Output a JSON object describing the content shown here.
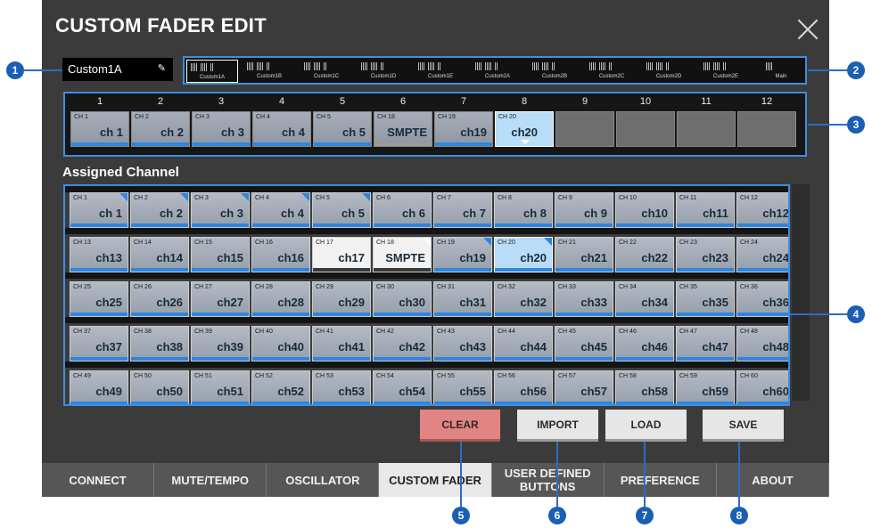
{
  "title": "CUSTOM FADER EDIT",
  "name_field": {
    "value": "Custom1A"
  },
  "banks": [
    {
      "label": "Custom1A",
      "selected": true
    },
    {
      "label": "Custom1B"
    },
    {
      "label": "Custom1C"
    },
    {
      "label": "Custom1D"
    },
    {
      "label": "Custom1E"
    },
    {
      "label": "Custom2A"
    },
    {
      "label": "Custom2B"
    },
    {
      "label": "Custom2C"
    },
    {
      "label": "Custom2D"
    },
    {
      "label": "Custom2E"
    },
    {
      "label": "Main"
    }
  ],
  "fader_slots": [
    {
      "num": "1",
      "ch": "CH 1",
      "name": "ch 1"
    },
    {
      "num": "2",
      "ch": "CH 2",
      "name": "ch 2"
    },
    {
      "num": "3",
      "ch": "CH 3",
      "name": "ch 3"
    },
    {
      "num": "4",
      "ch": "CH 4",
      "name": "ch 4"
    },
    {
      "num": "5",
      "ch": "CH 5",
      "name": "ch 5"
    },
    {
      "num": "6",
      "ch": "CH 18",
      "name": "SMPTE",
      "smpte": true
    },
    {
      "num": "7",
      "ch": "CH 19",
      "name": "ch19"
    },
    {
      "num": "8",
      "ch": "CH 20",
      "name": "ch20",
      "selected": true
    },
    {
      "num": "9",
      "ch": "",
      "name": ""
    },
    {
      "num": "10",
      "ch": "",
      "name": ""
    },
    {
      "num": "11",
      "ch": "",
      "name": ""
    },
    {
      "num": "12",
      "ch": "",
      "name": ""
    }
  ],
  "assigned_label": "Assigned Channel",
  "channels": [
    {
      "ch": "CH 1",
      "name": "ch 1",
      "assigned": true
    },
    {
      "ch": "CH 2",
      "name": "ch 2",
      "assigned": true
    },
    {
      "ch": "CH 3",
      "name": "ch 3",
      "assigned": true
    },
    {
      "ch": "CH 4",
      "name": "ch 4",
      "assigned": true
    },
    {
      "ch": "CH 5",
      "name": "ch 5",
      "assigned": true
    },
    {
      "ch": "CH 6",
      "name": "ch 6"
    },
    {
      "ch": "CH 7",
      "name": "ch 7"
    },
    {
      "ch": "CH 8",
      "name": "ch 8"
    },
    {
      "ch": "CH 9",
      "name": "ch 9"
    },
    {
      "ch": "CH 10",
      "name": "ch10"
    },
    {
      "ch": "CH 11",
      "name": "ch11"
    },
    {
      "ch": "CH 12",
      "name": "ch12"
    },
    {
      "ch": "CH 13",
      "name": "ch13"
    },
    {
      "ch": "CH 14",
      "name": "ch14"
    },
    {
      "ch": "CH 15",
      "name": "ch15"
    },
    {
      "ch": "CH 16",
      "name": "ch16"
    },
    {
      "ch": "CH 17",
      "name": "ch17",
      "style": "white"
    },
    {
      "ch": "CH 18",
      "name": "SMPTE",
      "style": "white",
      "assigned": true,
      "smpte": true
    },
    {
      "ch": "CH 19",
      "name": "ch19",
      "assigned": true
    },
    {
      "ch": "CH 20",
      "name": "ch20",
      "assigned": true,
      "selected": true
    },
    {
      "ch": "CH 21",
      "name": "ch21"
    },
    {
      "ch": "CH 22",
      "name": "ch22"
    },
    {
      "ch": "CH 23",
      "name": "ch23"
    },
    {
      "ch": "CH 24",
      "name": "ch24"
    },
    {
      "ch": "CH 25",
      "name": "ch25"
    },
    {
      "ch": "CH 26",
      "name": "ch26"
    },
    {
      "ch": "CH 27",
      "name": "ch27"
    },
    {
      "ch": "CH 28",
      "name": "ch28"
    },
    {
      "ch": "CH 29",
      "name": "ch29"
    },
    {
      "ch": "CH 30",
      "name": "ch30"
    },
    {
      "ch": "CH 31",
      "name": "ch31"
    },
    {
      "ch": "CH 32",
      "name": "ch32"
    },
    {
      "ch": "CH 33",
      "name": "ch33"
    },
    {
      "ch": "CH 34",
      "name": "ch34"
    },
    {
      "ch": "CH 35",
      "name": "ch35"
    },
    {
      "ch": "CH 36",
      "name": "ch36"
    },
    {
      "ch": "CH 37",
      "name": "ch37"
    },
    {
      "ch": "CH 38",
      "name": "ch38"
    },
    {
      "ch": "CH 39",
      "name": "ch39"
    },
    {
      "ch": "CH 40",
      "name": "ch40"
    },
    {
      "ch": "CH 41",
      "name": "ch41"
    },
    {
      "ch": "CH 42",
      "name": "ch42"
    },
    {
      "ch": "CH 43",
      "name": "ch43"
    },
    {
      "ch": "CH 44",
      "name": "ch44"
    },
    {
      "ch": "CH 45",
      "name": "ch45"
    },
    {
      "ch": "CH 46",
      "name": "ch46"
    },
    {
      "ch": "CH 47",
      "name": "ch47"
    },
    {
      "ch": "CH 48",
      "name": "ch48"
    },
    {
      "ch": "CH 49",
      "name": "ch49"
    },
    {
      "ch": "CH 50",
      "name": "ch50"
    },
    {
      "ch": "CH 51",
      "name": "ch51"
    },
    {
      "ch": "CH 52",
      "name": "ch52"
    },
    {
      "ch": "CH 53",
      "name": "ch53"
    },
    {
      "ch": "CH 54",
      "name": "ch54"
    },
    {
      "ch": "CH 55",
      "name": "ch55"
    },
    {
      "ch": "CH 56",
      "name": "ch56"
    },
    {
      "ch": "CH 57",
      "name": "ch57"
    },
    {
      "ch": "CH 58",
      "name": "ch58"
    },
    {
      "ch": "CH 59",
      "name": "ch59"
    },
    {
      "ch": "CH 60",
      "name": "ch60"
    }
  ],
  "buttons": {
    "clear": "CLEAR",
    "import": "IMPORT",
    "load": "LOAD",
    "save": "SAVE"
  },
  "tabs": [
    {
      "label": "CONNECT"
    },
    {
      "label": "MUTE/TEMPO"
    },
    {
      "label": "OSCILLATOR"
    },
    {
      "label": "CUSTOM FADER",
      "active": true
    },
    {
      "label": "USER DEFINED BUTTONS"
    },
    {
      "label": "PREFERENCE"
    },
    {
      "label": "ABOUT"
    }
  ],
  "callouts": [
    "1",
    "2",
    "3",
    "4",
    "5",
    "6",
    "7",
    "8"
  ],
  "colors": {
    "accent_blue": "#2e86de",
    "callout": "#1a5fb4",
    "clear_button": "#e28483",
    "panel": "#3b3b3b"
  }
}
